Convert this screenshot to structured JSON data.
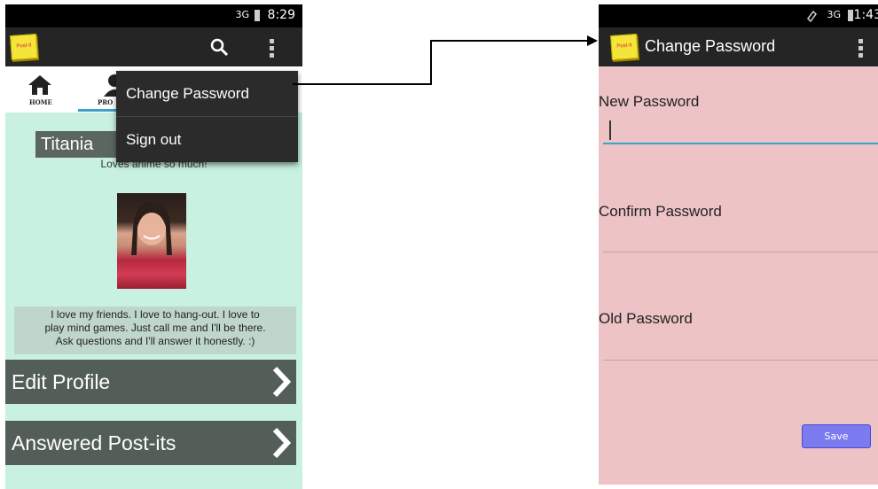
{
  "left_phone": {
    "statusbar": {
      "network": "3G",
      "time": "8:29"
    },
    "app_icon_text": "Post-it",
    "tabs": {
      "home_label": "HOME",
      "profile_label": "PRO"
    },
    "overflow_menu": {
      "items": [
        "Change Password",
        "Sign out"
      ]
    },
    "profile": {
      "name": "Titania",
      "tagline": "Loves anime so much!",
      "bio_lines": [
        "I love my friends. I love to hang-out. I love to",
        "play mind games. Just call me and I'll be there.",
        "Ask questions and I'll answer it honestly. :)"
      ]
    },
    "nav_buttons": [
      "Edit Profile",
      "Answered Post-its"
    ]
  },
  "right_phone": {
    "statusbar": {
      "network": "3G",
      "time": "1:43"
    },
    "app_icon_text": "Post-it",
    "title": "Change Password",
    "fields": [
      {
        "label": "New Password"
      },
      {
        "label": "Confirm Password"
      },
      {
        "label": "Old Password"
      }
    ],
    "save_label": "Save"
  },
  "colors": {
    "left_background": "#c9f1e1",
    "right_background": "#edc3c5",
    "action_bar": "#252525",
    "save_button": "#7b7bef",
    "nav_button": "#545e58"
  }
}
